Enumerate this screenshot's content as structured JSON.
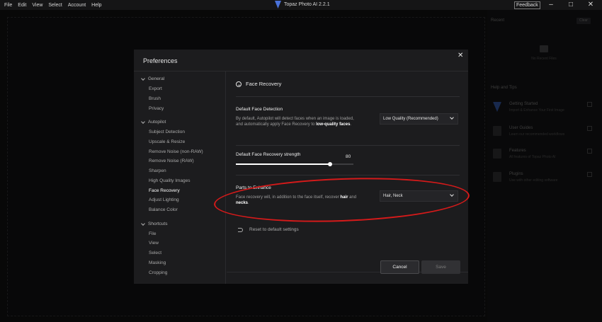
{
  "menubar": {
    "items": [
      "File",
      "Edit",
      "View",
      "Select",
      "Account",
      "Help"
    ]
  },
  "app": {
    "title": "Topaz Photo AI 2.2.1",
    "feedback": "Feedback",
    "icons": [
      "minimize-icon",
      "maximize-icon",
      "close-icon"
    ]
  },
  "right_panel": {
    "recent_title": "Recent",
    "clear": "Clear",
    "no_recent": "No Recent Files",
    "help_title": "Help and Tips",
    "items": [
      {
        "title": "Getting Started",
        "subtitle": "Import & Enhance Your First Image"
      },
      {
        "title": "User Guides",
        "subtitle": "Learn our recommended workflows"
      },
      {
        "title": "Features",
        "subtitle": "All features of Topaz Photo AI"
      },
      {
        "title": "Plugins",
        "subtitle": "Use with other editing software"
      }
    ]
  },
  "dialog": {
    "title": "Preferences",
    "sidebar": {
      "groups": [
        {
          "label": "General",
          "items": [
            "Export",
            "Brush",
            "Privacy"
          ]
        },
        {
          "label": "Autopilot",
          "items": [
            "Subject Detection",
            "Upscale & Resize",
            "Remove Noise (non-RAW)",
            "Remove Noise (RAW)",
            "Sharpen",
            "High Quality Images",
            "Face Recovery",
            "Adjust Lighting",
            "Balance Color"
          ]
        },
        {
          "label": "Shortcuts",
          "items": [
            "File",
            "View",
            "Select",
            "Masking",
            "Cropping"
          ]
        }
      ],
      "active": "Face Recovery"
    },
    "content": {
      "section_title": "Face Recovery",
      "detection": {
        "label": "Default Face Detection",
        "desc_pre": "By default, Autopilot will detect faces when an image is loaded, and automatically apply Face Recovery to ",
        "desc_bold": "low-quality faces",
        "desc_post": ".",
        "value": "Low Quality (Recommended)"
      },
      "strength": {
        "label": "Default Face Recovery strength",
        "value": 80,
        "max": 100
      },
      "parts": {
        "label": "Parts to Enhance",
        "desc_pre": "Face recovery will, in addition to the face itself, recover ",
        "desc_bold1": "hair",
        "desc_mid": " and ",
        "desc_bold2": "necks",
        "desc_post": ".",
        "value": "Hair, Neck"
      },
      "reset": "Reset to default settings"
    },
    "buttons": {
      "cancel": "Cancel",
      "save": "Save"
    }
  },
  "colors": {
    "annotation": "#d61a1a",
    "accent": "#4a72d9"
  }
}
